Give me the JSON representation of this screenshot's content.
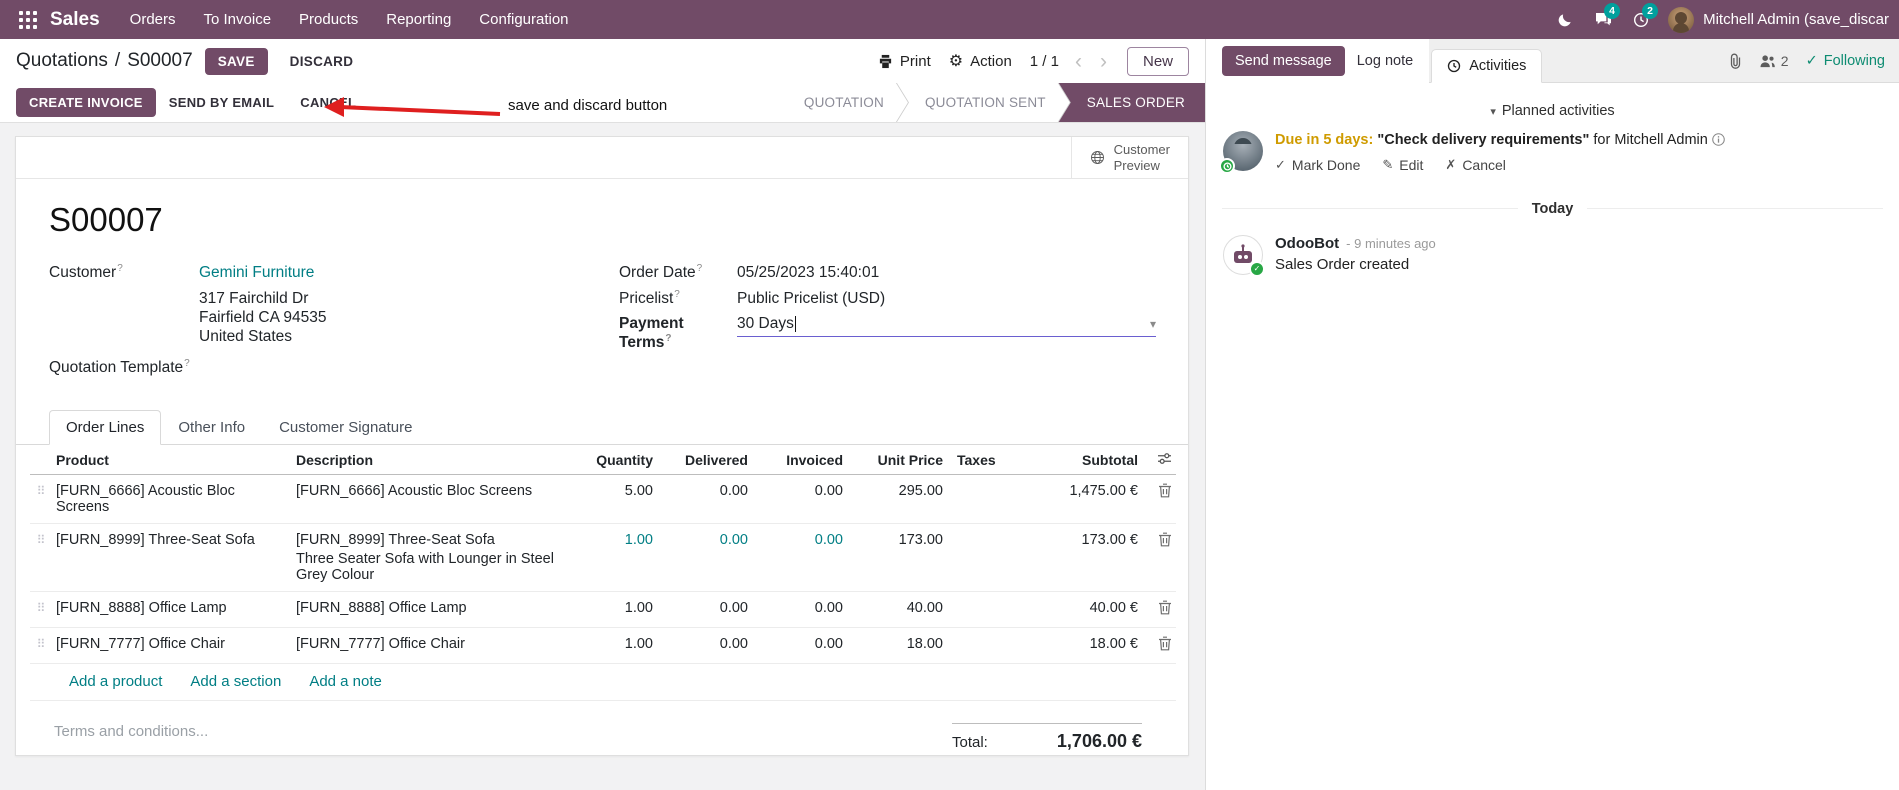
{
  "navbar": {
    "app": "Sales",
    "menus": [
      "Orders",
      "To Invoice",
      "Products",
      "Reporting",
      "Configuration"
    ],
    "messages_badge": "4",
    "activities_badge": "2",
    "user_name": "Mitchell Admin (save_discar"
  },
  "control": {
    "breadcrumb_parent": "Quotations",
    "breadcrumb_sep": "/",
    "breadcrumb_current": "S00007",
    "save": "SAVE",
    "discard": "DISCARD",
    "print": "Print",
    "action": "Action",
    "pager_value": "1 / 1",
    "new": "New"
  },
  "annotation": {
    "label": "save and discard button"
  },
  "statusbar": {
    "create_invoice": "CREATE INVOICE",
    "send_by_email": "SEND BY EMAIL",
    "cancel": "CANCEL",
    "states": [
      {
        "label": "QUOTATION"
      },
      {
        "label": "QUOTATION SENT"
      },
      {
        "label": "SALES ORDER"
      }
    ]
  },
  "sheet": {
    "customer_preview_line1": "Customer",
    "customer_preview_line2": "Preview",
    "title": "S00007",
    "customer_label": "Customer",
    "customer_name": "Gemini Furniture",
    "address_line1": "317 Fairchild Dr",
    "address_line2": "Fairfield CA 94535",
    "address_line3": "United States",
    "quotation_template_label": "Quotation Template",
    "order_date_label": "Order Date",
    "order_date": "05/25/2023 15:40:01",
    "pricelist_label": "Pricelist",
    "pricelist": "Public Pricelist (USD)",
    "payment_terms_label": "Payment Terms",
    "payment_terms": "30 Days",
    "tabs": [
      "Order Lines",
      "Other Info",
      "Customer Signature"
    ],
    "table": {
      "headers": {
        "product": "Product",
        "description": "Description",
        "quantity": "Quantity",
        "delivered": "Delivered",
        "invoiced": "Invoiced",
        "unit_price": "Unit Price",
        "taxes": "Taxes",
        "subtotal": "Subtotal"
      },
      "rows": [
        {
          "product": "[FURN_6666] Acoustic Bloc Screens",
          "description": "[FURN_6666] Acoustic Bloc Screens",
          "description2": "",
          "quantity": "5.00",
          "delivered": "0.00",
          "invoiced": "0.00",
          "unit_price": "295.00",
          "taxes": "",
          "subtotal": "1,475.00 €"
        },
        {
          "product": "[FURN_8999] Three-Seat Sofa",
          "description": "[FURN_8999] Three-Seat Sofa",
          "description2": "Three Seater Sofa with Lounger in Steel Grey Colour",
          "quantity": "1.00",
          "delivered": "0.00",
          "invoiced": "0.00",
          "unit_price": "173.00",
          "taxes": "",
          "subtotal": "173.00 €"
        },
        {
          "product": "[FURN_8888] Office Lamp",
          "description": "[FURN_8888] Office Lamp",
          "description2": "",
          "quantity": "1.00",
          "delivered": "0.00",
          "invoiced": "0.00",
          "unit_price": "40.00",
          "taxes": "",
          "subtotal": "40.00 €"
        },
        {
          "product": "[FURN_7777] Office Chair",
          "description": "[FURN_7777] Office Chair",
          "description2": "",
          "quantity": "1.00",
          "delivered": "0.00",
          "invoiced": "0.00",
          "unit_price": "18.00",
          "taxes": "",
          "subtotal": "18.00 €"
        }
      ],
      "add_product": "Add a product",
      "add_section": "Add a section",
      "add_note": "Add a note"
    },
    "terms_placeholder": "Terms and conditions...",
    "total_label": "Total:",
    "total_value": "1,706.00 €"
  },
  "chatter": {
    "send_message": "Send message",
    "log_note": "Log note",
    "activities": "Activities",
    "followers_count": "2",
    "following": "Following",
    "planned_activities": "Planned activities",
    "activity_due": "Due in 5 days:",
    "activity_summary": "\"Check delivery requirements\"",
    "activity_for": "for Mitchell Admin",
    "mark_done": "Mark Done",
    "edit": "Edit",
    "cancel": "Cancel",
    "today": "Today",
    "author": "OdooBot",
    "time": "- 9 minutes ago",
    "body": "Sales Order created"
  },
  "icons": {
    "gear": "⚙",
    "check": "✓",
    "pencil": "✎",
    "x": "✗",
    "caret_down": "▾",
    "chevron_left": "‹",
    "chevron_right": "›",
    "drag": "⠿",
    "help": "?"
  },
  "colors": {
    "primary": "#714B67",
    "link": "#017e84",
    "badge": "#00a09d",
    "due_amber": "#cf9b00",
    "annotation_red": "#df1f1f"
  }
}
